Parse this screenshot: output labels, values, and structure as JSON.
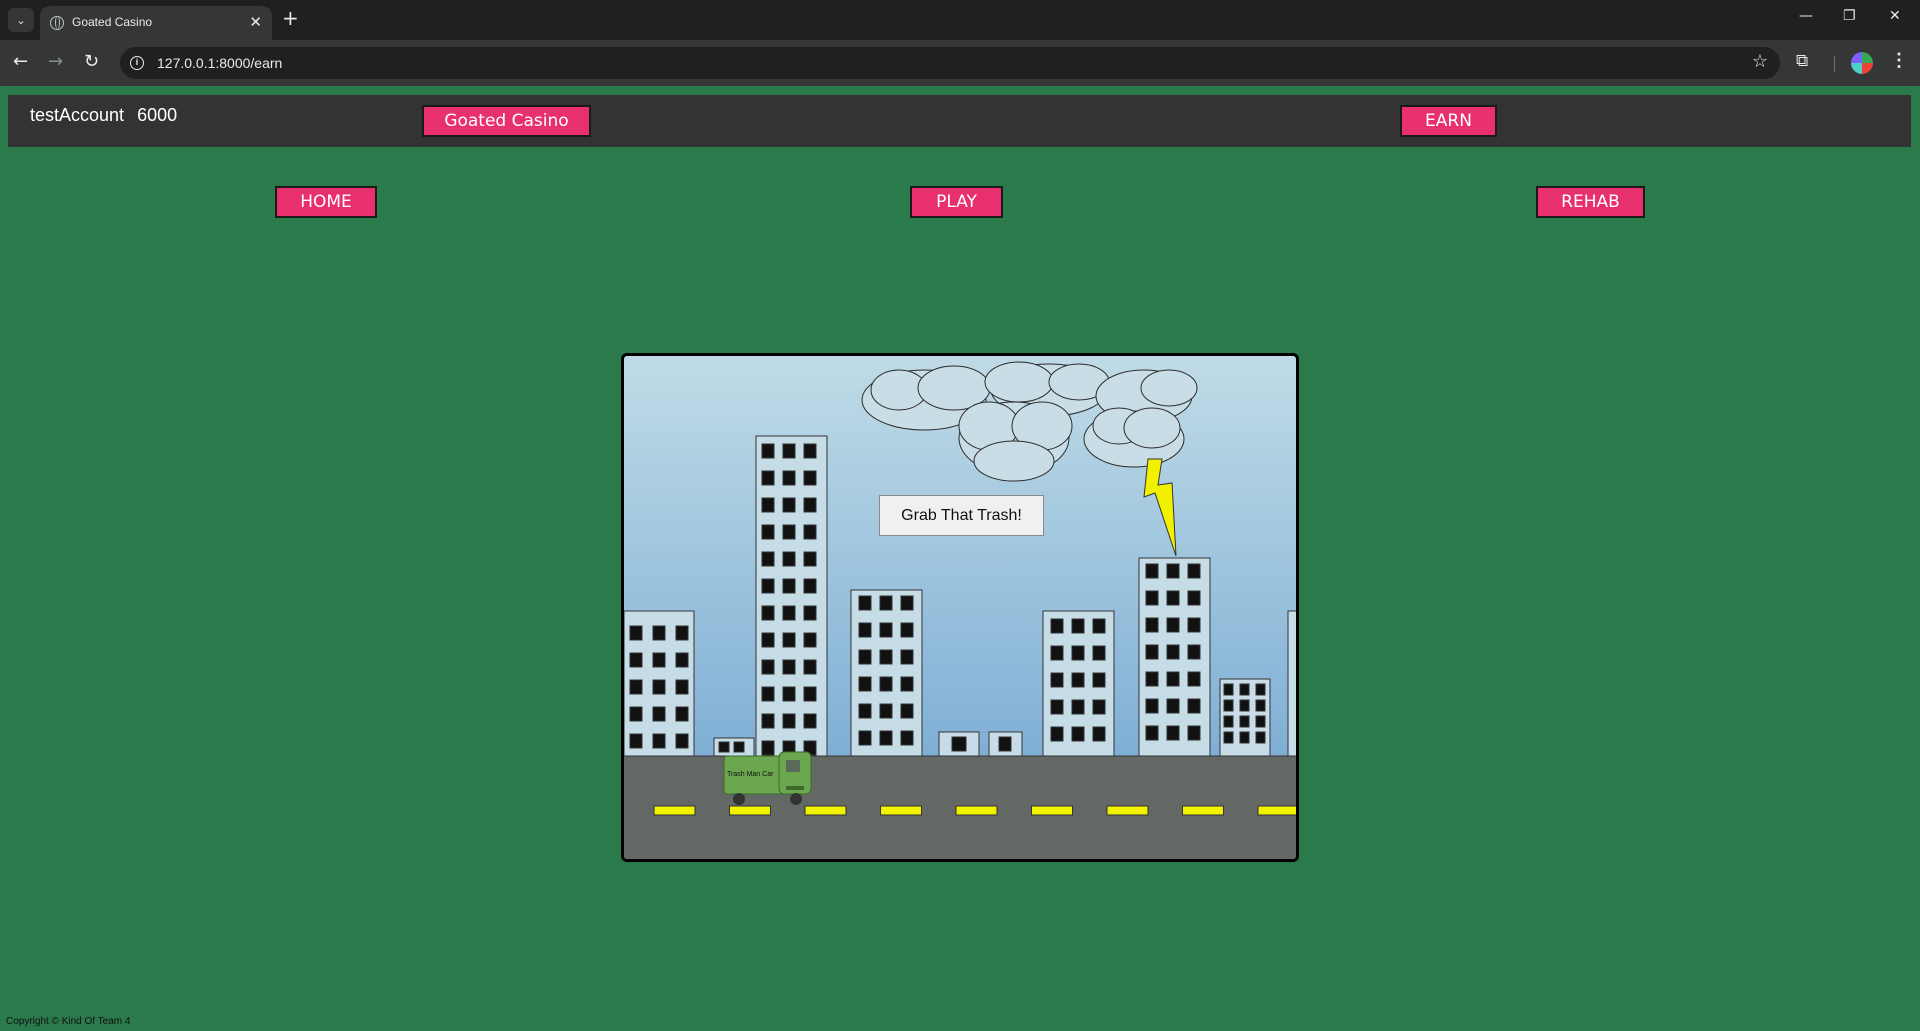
{
  "browser": {
    "tab_title": "Goated Casino",
    "url": "127.0.0.1:8000/earn",
    "icons": [
      "tab-list-icon",
      "globe-icon",
      "close-icon",
      "new-tab-icon",
      "minimize-icon",
      "restore-icon",
      "window-close-icon",
      "back-icon",
      "forward-icon",
      "reload-icon",
      "site-info-icon",
      "star-icon",
      "extensions-icon",
      "profile-icon",
      "menu-icon"
    ]
  },
  "header": {
    "username": "testAccount",
    "balance": "6000",
    "brand_button": "Goated Casino",
    "earn_button": "EARN"
  },
  "nav": {
    "home": "HOME",
    "play": "PLAY",
    "rehab": "REHAB"
  },
  "game": {
    "action_button": "Grab That Trash!",
    "truck_label": "Trash Man Car",
    "colors": {
      "road": "#636865",
      "lane_marking": "#f2f200",
      "building": "#c6dde8",
      "window": "#111111",
      "truck": "#6aa74f",
      "lightning": "#f2f200"
    }
  },
  "footer": {
    "copyright": "Copyright © Kind Of Team 4"
  }
}
